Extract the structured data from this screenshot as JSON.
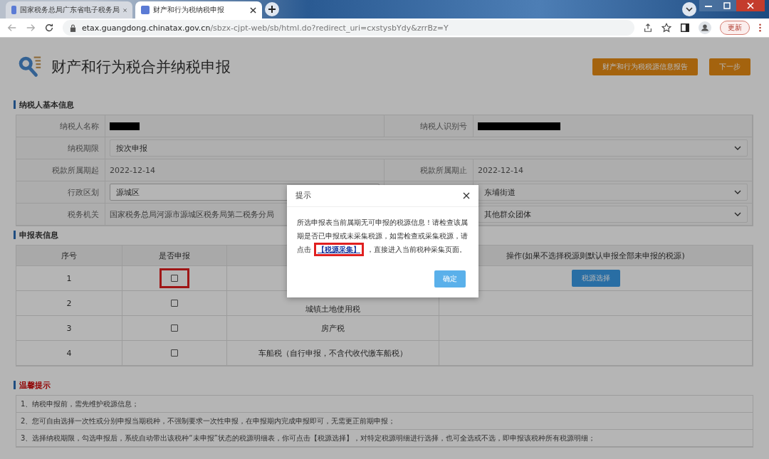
{
  "browser": {
    "tabs": [
      {
        "title": "国家税务总局广东省电子税务局",
        "selected": false
      },
      {
        "title": "财产和行为税纳税申报",
        "selected": true
      }
    ],
    "url_host": "etax.guangdong.chinatax.gov.cn",
    "url_path": "/sbzx-cjpt-web/sb/html.do?redirect_uri=cxstysbYdy&zrrBz=Y",
    "update_button": "更新"
  },
  "page": {
    "title": "财产和行为税合并纳税申报",
    "buttons": [
      "财产和行为税税源信息报告",
      "下一步"
    ],
    "basic_info": {
      "heading": "纳税人基本信息",
      "rows": [
        {
          "cells": [
            {
              "label": "纳税人名称",
              "kind": "redacted"
            },
            {
              "label": "纳税人识别号",
              "kind": "redacted"
            }
          ]
        },
        {
          "cells": [
            {
              "label": "纳税期限",
              "kind": "select",
              "value": "按次申报"
            }
          ]
        },
        {
          "cells": [
            {
              "label": "税款所属期起",
              "kind": "text",
              "value": "2022-12-14"
            },
            {
              "label": "税款所属期止",
              "kind": "text",
              "value": "2022-12-14"
            }
          ]
        },
        {
          "cells": [
            {
              "label": "行政区划",
              "kind": "input",
              "value": "源城区"
            },
            {
              "kind": "select",
              "value": "东埔街道"
            }
          ]
        },
        {
          "cells": [
            {
              "label": "税务机关",
              "kind": "text",
              "value": "国家税务总局河源市源城区税务局第二税务分局"
            },
            {
              "kind": "select",
              "value": "其他群众团体"
            }
          ]
        }
      ]
    },
    "declarations": {
      "heading": "申报表信息",
      "columns": [
        "序号",
        "是否申报",
        "",
        "操作(如果不选择税源则默认申报全部未申报的税源)"
      ],
      "rows": [
        {
          "index": "1",
          "checked": false,
          "highlighted": true,
          "action": "税源选择"
        },
        {
          "index": "2",
          "checked": false,
          "highlighted": false,
          "tax": "城镇土地使用税"
        },
        {
          "index": "3",
          "checked": false,
          "highlighted": false,
          "tax": "房产税"
        },
        {
          "index": "4",
          "checked": false,
          "highlighted": false,
          "tax": "车船税（自行申报，不含代收代缴车船税）"
        }
      ]
    },
    "tips": {
      "heading": "温馨提示",
      "items": [
        "1、纳税申报前，需先维护税源信息；",
        "2、您可自由选择一次性或分别申报当期税种，不强制要求一次性申报，在申报期内完成申报即可，无需更正前期申报；",
        "3、选择纳税期限，勾选申报后，系统自动带出该税种“未申报”状态的税源明细表，你可点击【税源选择】，对特定税源明细进行选择，也可全选或不选，即申报该税种所有税源明细；"
      ]
    }
  },
  "dialog": {
    "title": "提示",
    "text_before": "所选申报表当前属期无可申报的税源信息！请检查该属期是否已申报或未采集税源，如需检查或采集税源，请点击",
    "link": "【税源采集】",
    "link_highlighted": true,
    "text_after": "，直接进入当前税种采集页面。",
    "ok_button": "确定"
  }
}
